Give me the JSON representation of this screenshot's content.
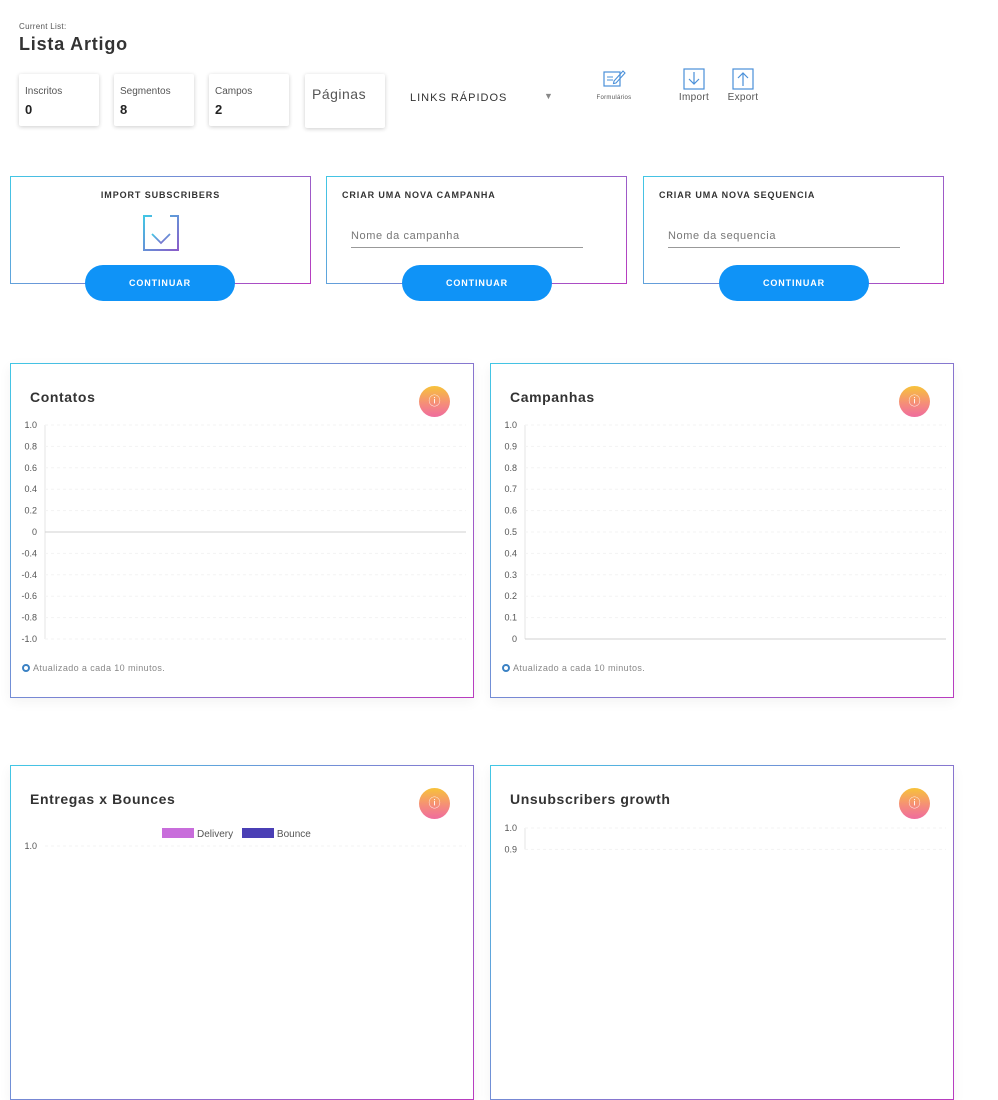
{
  "header": {
    "current_list_label": "Current List:",
    "list_name": "Lista Artigo"
  },
  "stats": [
    {
      "label": "Inscritos",
      "value": "0"
    },
    {
      "label": "Segmentos",
      "value": "8"
    },
    {
      "label": "Campos",
      "value": "2"
    }
  ],
  "paginas_label": "Páginas",
  "quick_links": {
    "label": "LINKS RÁPIDOS",
    "caret": "▼"
  },
  "tools": {
    "formularios": "Formulários",
    "import": "Import",
    "export": "Export"
  },
  "actions": {
    "import": {
      "title": "IMPORT SUBSCRIBERS",
      "button": "CONTINUAR"
    },
    "campanha": {
      "title": "CRIAR UMA NOVA CAMPANHA",
      "placeholder": "Nome da campanha",
      "button": "CONTINUAR"
    },
    "sequencia": {
      "title": "CRIAR UMA NOVA SEQUENCIA",
      "placeholder": "Nome da sequencia",
      "button": "CONTINUAR"
    }
  },
  "cards": {
    "contatos": {
      "title": "Contatos",
      "updated": "Atualizado a cada 10 minutos."
    },
    "campanhas": {
      "title": "Campanhas",
      "updated": "Atualizado a cada 10 minutos."
    },
    "entregas": {
      "title": "Entregas x Bounces",
      "legend": [
        "Delivery",
        "Bounce"
      ]
    },
    "unsubscribers": {
      "title": "Unsubscribers growth"
    }
  },
  "info_icon": "ⓘ",
  "colors": {
    "accent": "#0f93f7",
    "delivery": "#c86ddb",
    "bounce": "#4a3fb5",
    "border_start": "#41c7e5",
    "border_end": "#b93bbf"
  },
  "chart_data": [
    {
      "type": "line",
      "title": "Contatos",
      "ylim": [
        -1.0,
        1.0
      ],
      "y_ticks": [
        "1.0",
        "0.8",
        "0.6",
        "0.4",
        "0.2",
        "0",
        "-0.4",
        "-0.4",
        "-0.6",
        "-0.8",
        "-1.0"
      ],
      "series": []
    },
    {
      "type": "line",
      "title": "Campanhas",
      "ylim": [
        0,
        1.0
      ],
      "y_ticks": [
        "1.0",
        "0.9",
        "0.8",
        "0.7",
        "0.6",
        "0.5",
        "0.4",
        "0.3",
        "0.2",
        "0.1",
        "0"
      ],
      "series": []
    },
    {
      "type": "bar",
      "title": "Entregas x Bounces",
      "y_ticks": [
        "1.0"
      ],
      "series": [
        {
          "name": "Delivery",
          "values": []
        },
        {
          "name": "Bounce",
          "values": []
        }
      ]
    },
    {
      "type": "line",
      "title": "Unsubscribers growth",
      "y_ticks": [
        "1.0",
        "0.9"
      ],
      "series": []
    }
  ]
}
